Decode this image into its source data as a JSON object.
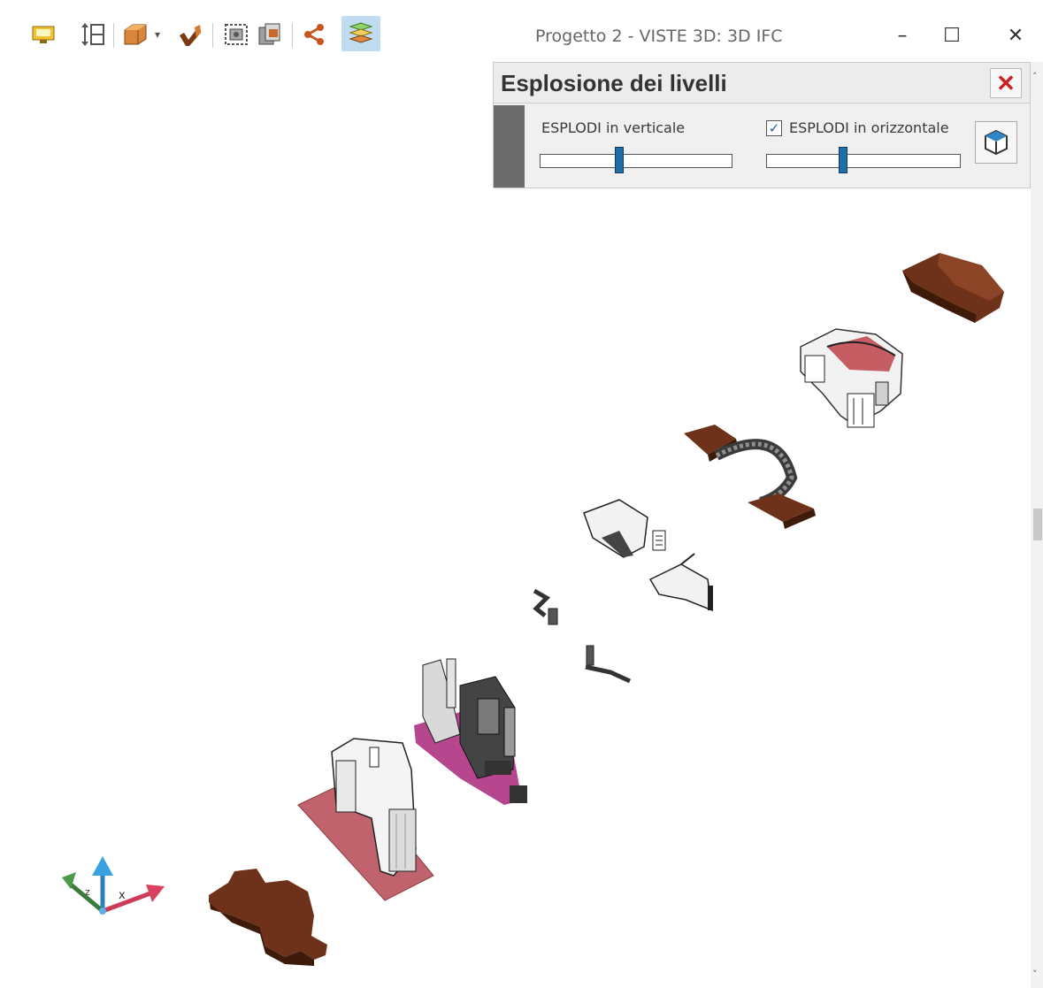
{
  "window": {
    "title": "Progetto 2 -  VISTE 3D: 3D IFC",
    "minimize_glyph": "–",
    "maximize_glyph": "☐",
    "close_glyph": "✕"
  },
  "toolbar": {
    "icons": [
      "view-presentation-icon",
      "vertical-split-icon",
      "box-icon",
      "dropdown-arrow-icon",
      "checkmark-icon",
      "zoom-frame-icon",
      "copy-pages-icon",
      "share-icon",
      "layers-explode-icon"
    ],
    "dropdown_glyph": "▾"
  },
  "panel": {
    "title": "Esplosione dei livelli",
    "close_glyph": "✕",
    "vertical_label": "ESPLODI in verticale",
    "horizontal_label": "ESPLODI in orizzontale",
    "vertical_slider_fraction": 0.41,
    "horizontal_slider_fraction": 0.39,
    "horizontal_checked": true,
    "checkbox_glyph": "✓",
    "reset_button_icon": "3d-cube-icon"
  },
  "axes_gizmo": {
    "x_label": "x",
    "z_label": "z"
  },
  "scrollbar": {
    "up_glyph": "˄",
    "down_glyph": "˅"
  },
  "colors": {
    "slab_brown": "#6e321a",
    "floor_pink": "#c0636c",
    "magenta_floor": "#b6468e",
    "slider_thumb": "#1e6ea8",
    "close_red": "#cc1f1f"
  }
}
